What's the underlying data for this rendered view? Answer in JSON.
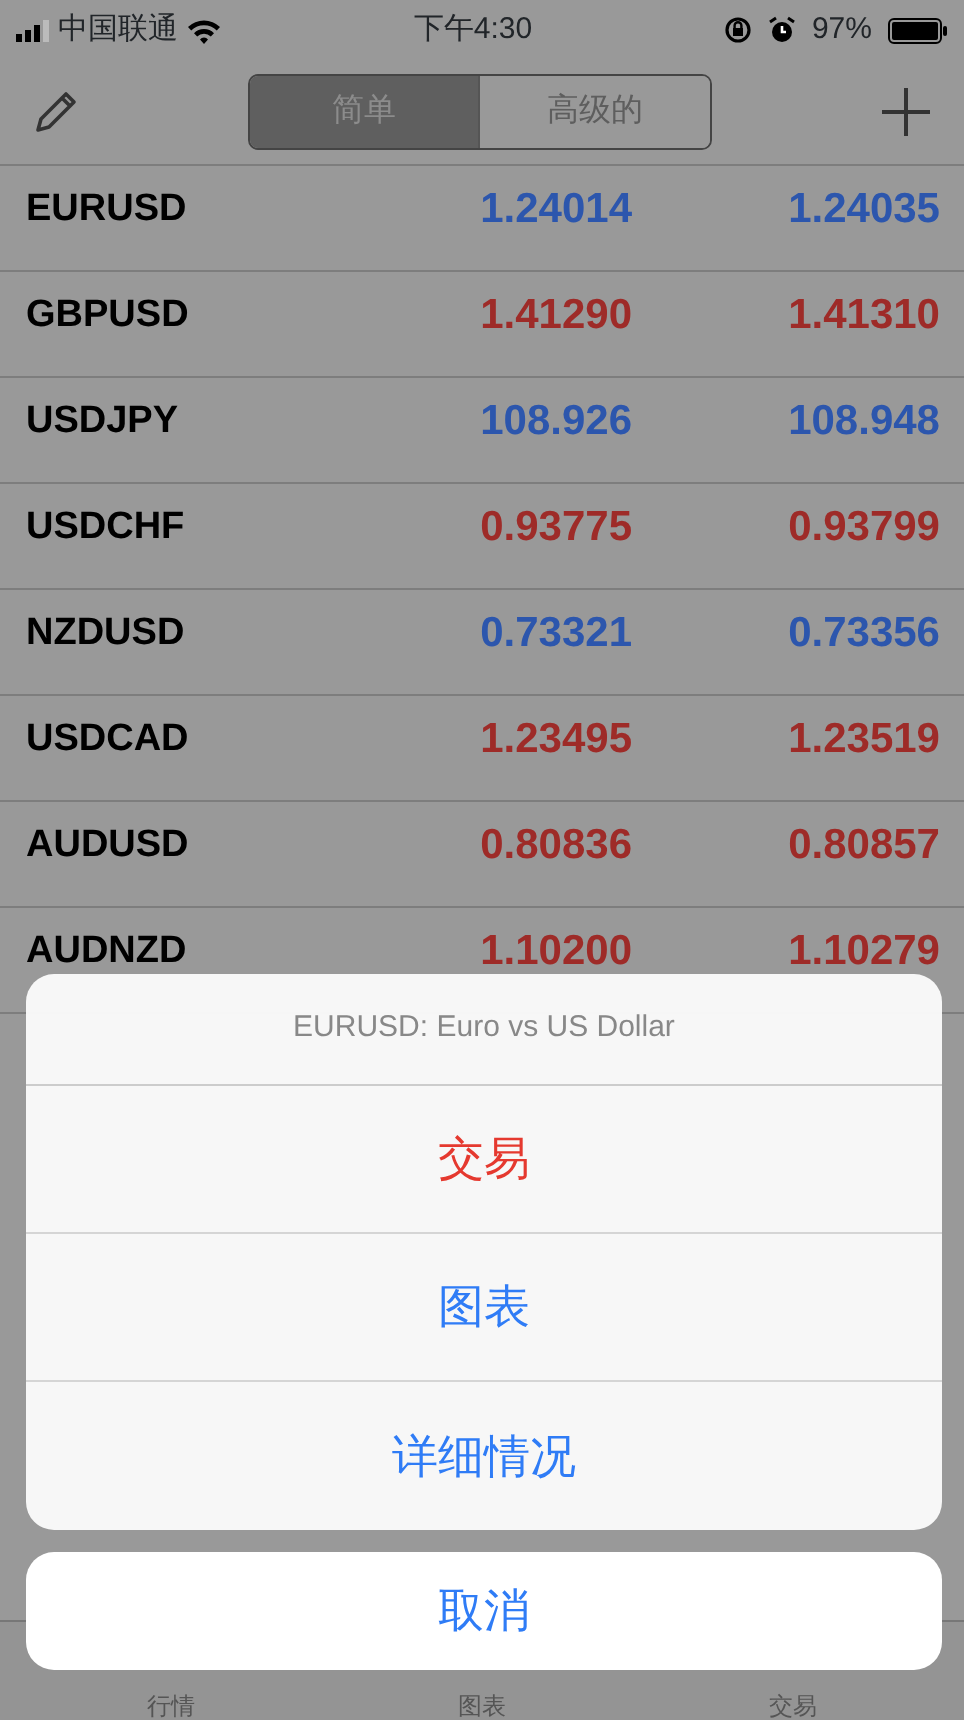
{
  "status_bar": {
    "carrier": "中国联通",
    "time": "下午4:30",
    "battery": "97%"
  },
  "segments": [
    {
      "label": "简单",
      "selected": true
    },
    {
      "label": "高级的",
      "selected": false
    }
  ],
  "quotes": [
    {
      "symbol": "EURUSD",
      "bid": "1.24014",
      "ask": "1.24035",
      "color": "#2c56ad"
    },
    {
      "symbol": "GBPUSD",
      "bid": "1.41290",
      "ask": "1.41310",
      "color": "#9e2b28"
    },
    {
      "symbol": "USDJPY",
      "bid": "108.926",
      "ask": "108.948",
      "color": "#2c56ad"
    },
    {
      "symbol": "USDCHF",
      "bid": "0.93775",
      "ask": "0.93799",
      "color": "#9e2b28"
    },
    {
      "symbol": "NZDUSD",
      "bid": "0.73321",
      "ask": "0.73356",
      "color": "#2c56ad"
    },
    {
      "symbol": "USDCAD",
      "bid": "1.23495",
      "ask": "1.23519",
      "color": "#9e2b28"
    },
    {
      "symbol": "AUDUSD",
      "bid": "0.80836",
      "ask": "0.80857",
      "color": "#9e2b28"
    },
    {
      "symbol": "AUDNZD",
      "bid": "1.10200",
      "ask": "1.10279",
      "color": "#9e2b28"
    }
  ],
  "action_sheet": {
    "title": "EURUSD: Euro vs US Dollar",
    "actions": [
      {
        "label": "交易",
        "kind": "destructive"
      },
      {
        "label": "图表",
        "kind": "default"
      },
      {
        "label": "详细情况",
        "kind": "default"
      }
    ],
    "cancel": "取消"
  },
  "tab_bar": [
    {
      "label": "行情"
    },
    {
      "label": "图表"
    },
    {
      "label": "交易"
    }
  ]
}
